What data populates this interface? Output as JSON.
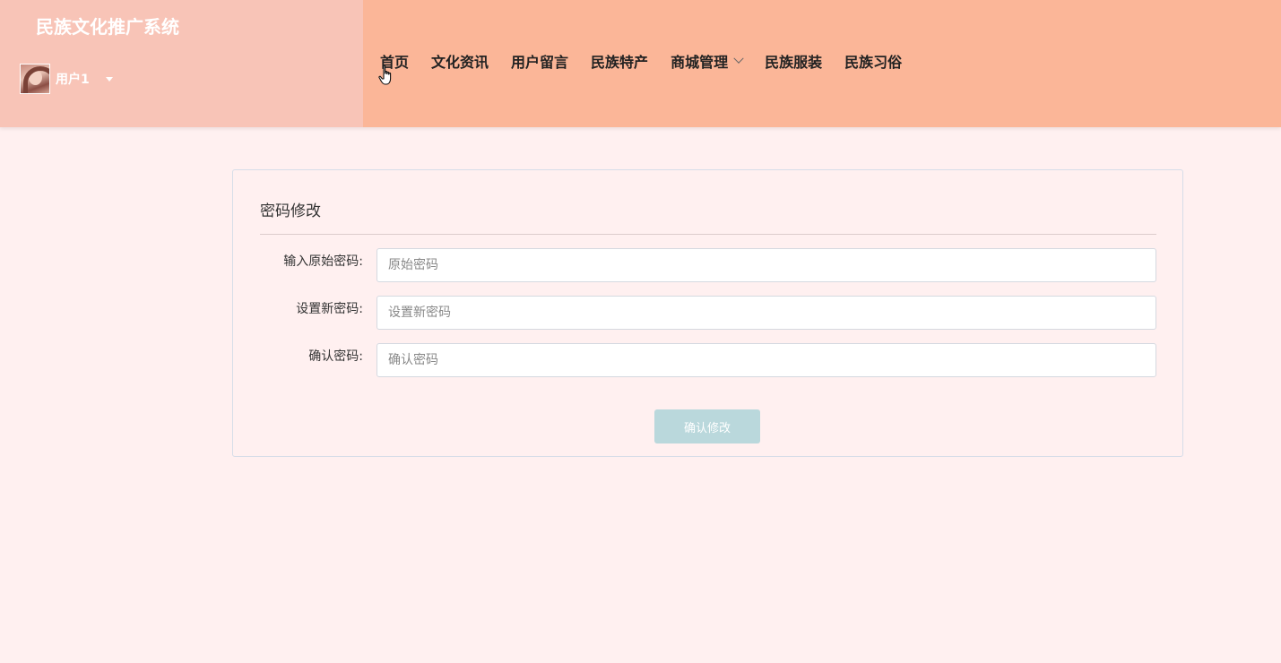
{
  "app": {
    "title": "民族文化推广系统"
  },
  "user": {
    "name": "用户1"
  },
  "nav": {
    "items": [
      {
        "label": "首页"
      },
      {
        "label": "文化资讯"
      },
      {
        "label": "用户留言"
      },
      {
        "label": "民族特产"
      },
      {
        "label": "商城管理",
        "has_dropdown": true
      },
      {
        "label": "民族服装"
      },
      {
        "label": "民族习俗"
      }
    ]
  },
  "form": {
    "title": "密码修改",
    "fields": [
      {
        "label": "输入原始密码:",
        "placeholder": "原始密码",
        "value": ""
      },
      {
        "label": "设置新密码:",
        "placeholder": "设置新密码",
        "value": ""
      },
      {
        "label": "确认密码:",
        "placeholder": "确认密码",
        "value": ""
      }
    ],
    "submit_label": "确认修改"
  },
  "colors": {
    "header_bg": "#fbb698",
    "brand_panel_bg": "#f8c4b7",
    "page_bg": "#fff0f0",
    "button_bg": "#bad8dc"
  },
  "icons": {
    "avatar": "user-avatar-photo",
    "user_caret": "caret-down-icon",
    "nav_dropdown": "chevron-down-icon",
    "cursor": "hand-pointer-icon"
  }
}
